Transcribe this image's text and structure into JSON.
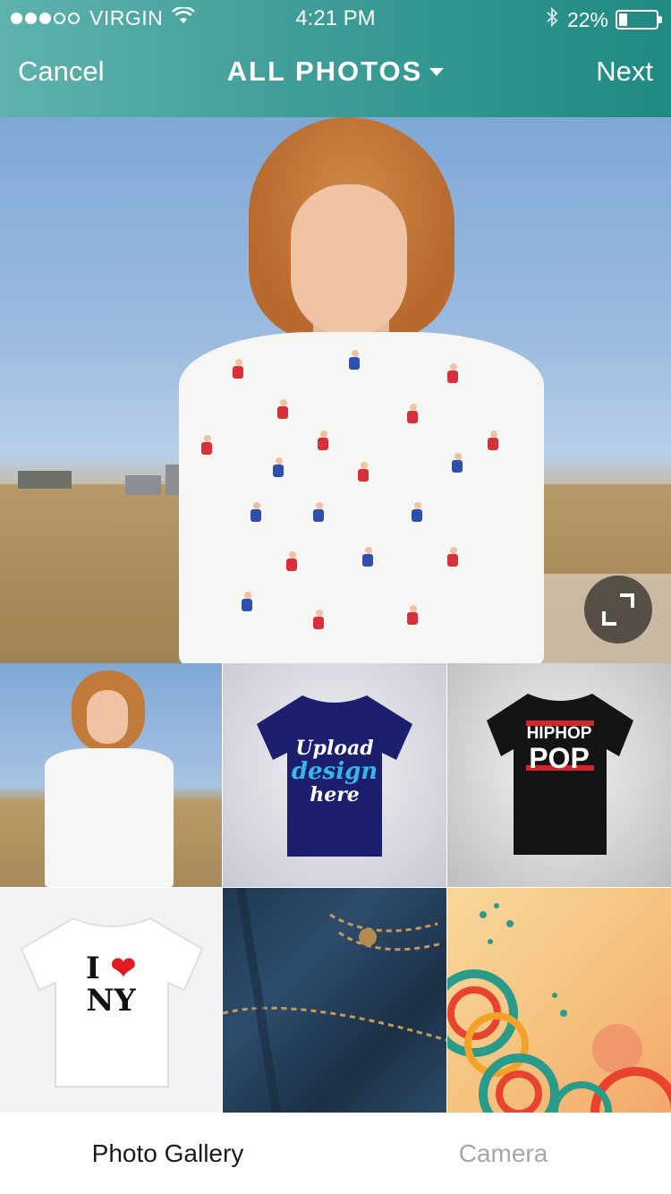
{
  "status_bar": {
    "carrier": "VIRGIN",
    "signal_bars_filled": 3,
    "signal_bars_total": 5,
    "time": "4:21 PM",
    "battery_percent": "22%",
    "battery_level": 0.22
  },
  "nav": {
    "cancel_label": "Cancel",
    "title": "ALL PHOTOS",
    "next_label": "Next"
  },
  "thumbnails": [
    {
      "subject": "woman-in-ski-print-shirt"
    },
    {
      "subject": "navy-tshirt-mockup",
      "lines": [
        "Upload",
        "design",
        "here"
      ]
    },
    {
      "subject": "black-tshirt",
      "lines": [
        "HIPHOP",
        "POP"
      ]
    },
    {
      "subject": "white-tshirt",
      "lines": [
        "I",
        "NY"
      ]
    },
    {
      "subject": "denim-jeans-closeup"
    },
    {
      "subject": "retro-circles-pattern"
    }
  ],
  "tabs": {
    "gallery_label": "Photo Gallery",
    "camera_label": "Camera",
    "active": "gallery"
  },
  "colors": {
    "header_start": "#5fb2ae",
    "header_end": "#1f8a82",
    "tab_active": "#1a1a1a",
    "tab_inactive": "#a6a6a6"
  }
}
